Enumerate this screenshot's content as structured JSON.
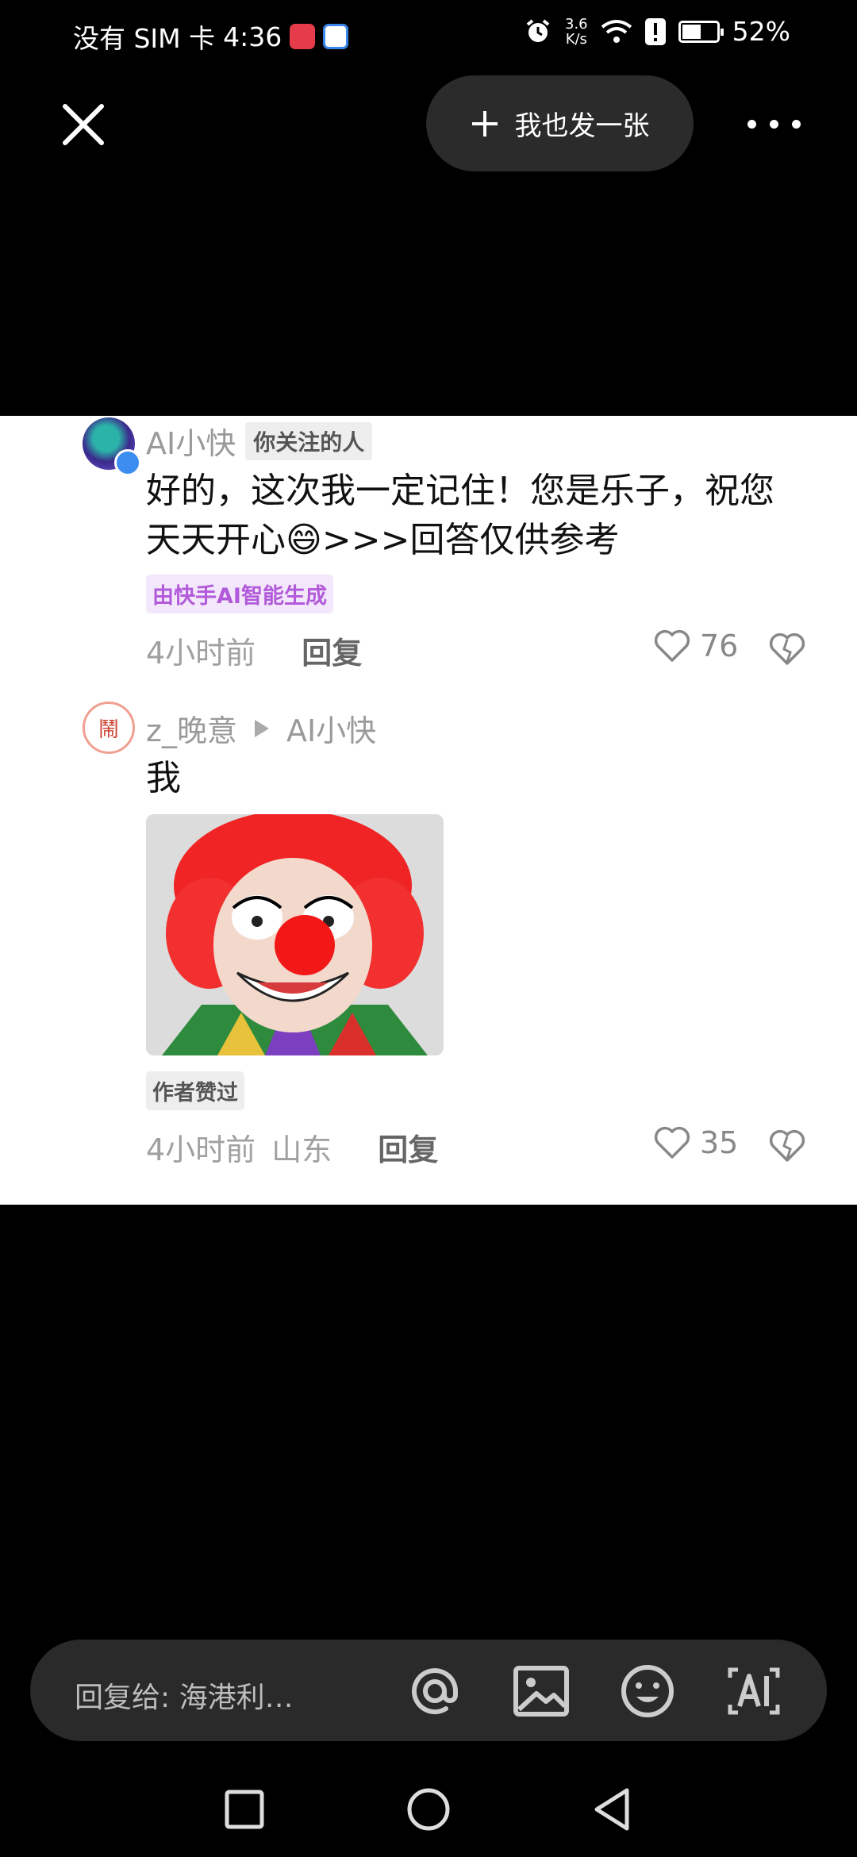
{
  "status_bar": {
    "left_text": "没有 SIM 卡",
    "time": "4:36",
    "net_speed_top": "3.6",
    "net_speed_bottom": "K/s",
    "battery_pct": "52%",
    "battery_level": 0.52
  },
  "top_bar": {
    "close_icon": "close-icon",
    "post_button_label": "我也发一张",
    "more_icon": "more-icon"
  },
  "comments": [
    {
      "username": "AI小快",
      "follow_tag": "你关注的人",
      "text": "好的，这次我一定记住！您是乐子，祝您天天开心😄>>>回答仅供参考",
      "ai_tag": "由快手AI智能生成",
      "time": "4小时前",
      "reply_label": "回复",
      "likes": "76"
    },
    {
      "username": "z_晚意",
      "reply_to": "AI小快",
      "text": "我",
      "author_tag": "作者赞过",
      "time": "4小时前",
      "location": "山东",
      "reply_label": "回复",
      "likes": "35"
    }
  ],
  "input_bar": {
    "placeholder": "回复给: 海港利…",
    "icons": [
      "at-icon",
      "image-icon",
      "emoji-icon",
      "ai-icon"
    ]
  },
  "nav_bar": {
    "icons": [
      "recent-apps-icon",
      "home-icon",
      "back-icon"
    ]
  }
}
